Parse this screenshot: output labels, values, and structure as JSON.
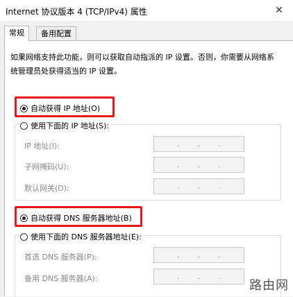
{
  "window": {
    "title": "Internet 协议版本 4 (TCP/IPv4) 属性",
    "close_glyph": "✕"
  },
  "tabs": [
    {
      "label": "常规",
      "active": true
    },
    {
      "label": "备用配置",
      "active": false
    }
  ],
  "description": "如果网络支持此功能，则可以获取自动指派的 IP 设置。否则，你需要从网络系统管理员处获得适当的 IP 设置。",
  "ip_section": {
    "auto_label": "自动获得 IP 地址(O)",
    "auto_checked": true,
    "manual_label": "使用下面的 IP 地址(S):",
    "manual_checked": false,
    "fields": [
      {
        "label": "IP 地址(I):",
        "dots": "."
      },
      {
        "label": "子网掩码(U):",
        "dots": "."
      },
      {
        "label": "默认网关(D):",
        "dots": "."
      }
    ]
  },
  "dns_section": {
    "auto_label": "自动获得 DNS 服务器地址(B)",
    "auto_checked": true,
    "manual_label": "使用下面的 DNS 服务器地址(E):",
    "manual_checked": false,
    "fields": [
      {
        "label": "首选 DNS 服务器(P):",
        "dots": "."
      },
      {
        "label": "备用 DNS 服务器(A):",
        "dots": "."
      }
    ]
  },
  "watermark": "路由网",
  "colors": {
    "highlight": "#e8171b"
  }
}
